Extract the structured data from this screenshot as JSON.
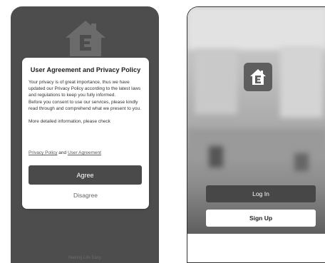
{
  "consent_screen": {
    "title": "User Agreement and Privacy Policy",
    "paragraph_1": "Your privacy is of great importance, thus we have updated our Privacy Policy according to the latest laws and regulations to keep you fully informed.",
    "paragraph_2": "Before you consent to use our services, please kindly read through and comprehend what we present to you.",
    "paragraph_3": "More detailed information, please check",
    "privacy_link": "Privacy Policy",
    "and_text": "and",
    "agreement_link": "User Agreement",
    "agree_label": "Agree",
    "disagree_label": "Disagree",
    "tagline": "Making Life Easy"
  },
  "welcome_screen": {
    "login_label": "Log In",
    "signup_label": "Sign Up"
  },
  "icons": [
    "house-logo-icon",
    "app-logo-icon"
  ],
  "colors": {
    "background_dark": "#4d4d4d",
    "primary_button": "#4a4a4a",
    "dialog_bg": "#ffffff",
    "logo_bg": "#5e5e5e"
  }
}
